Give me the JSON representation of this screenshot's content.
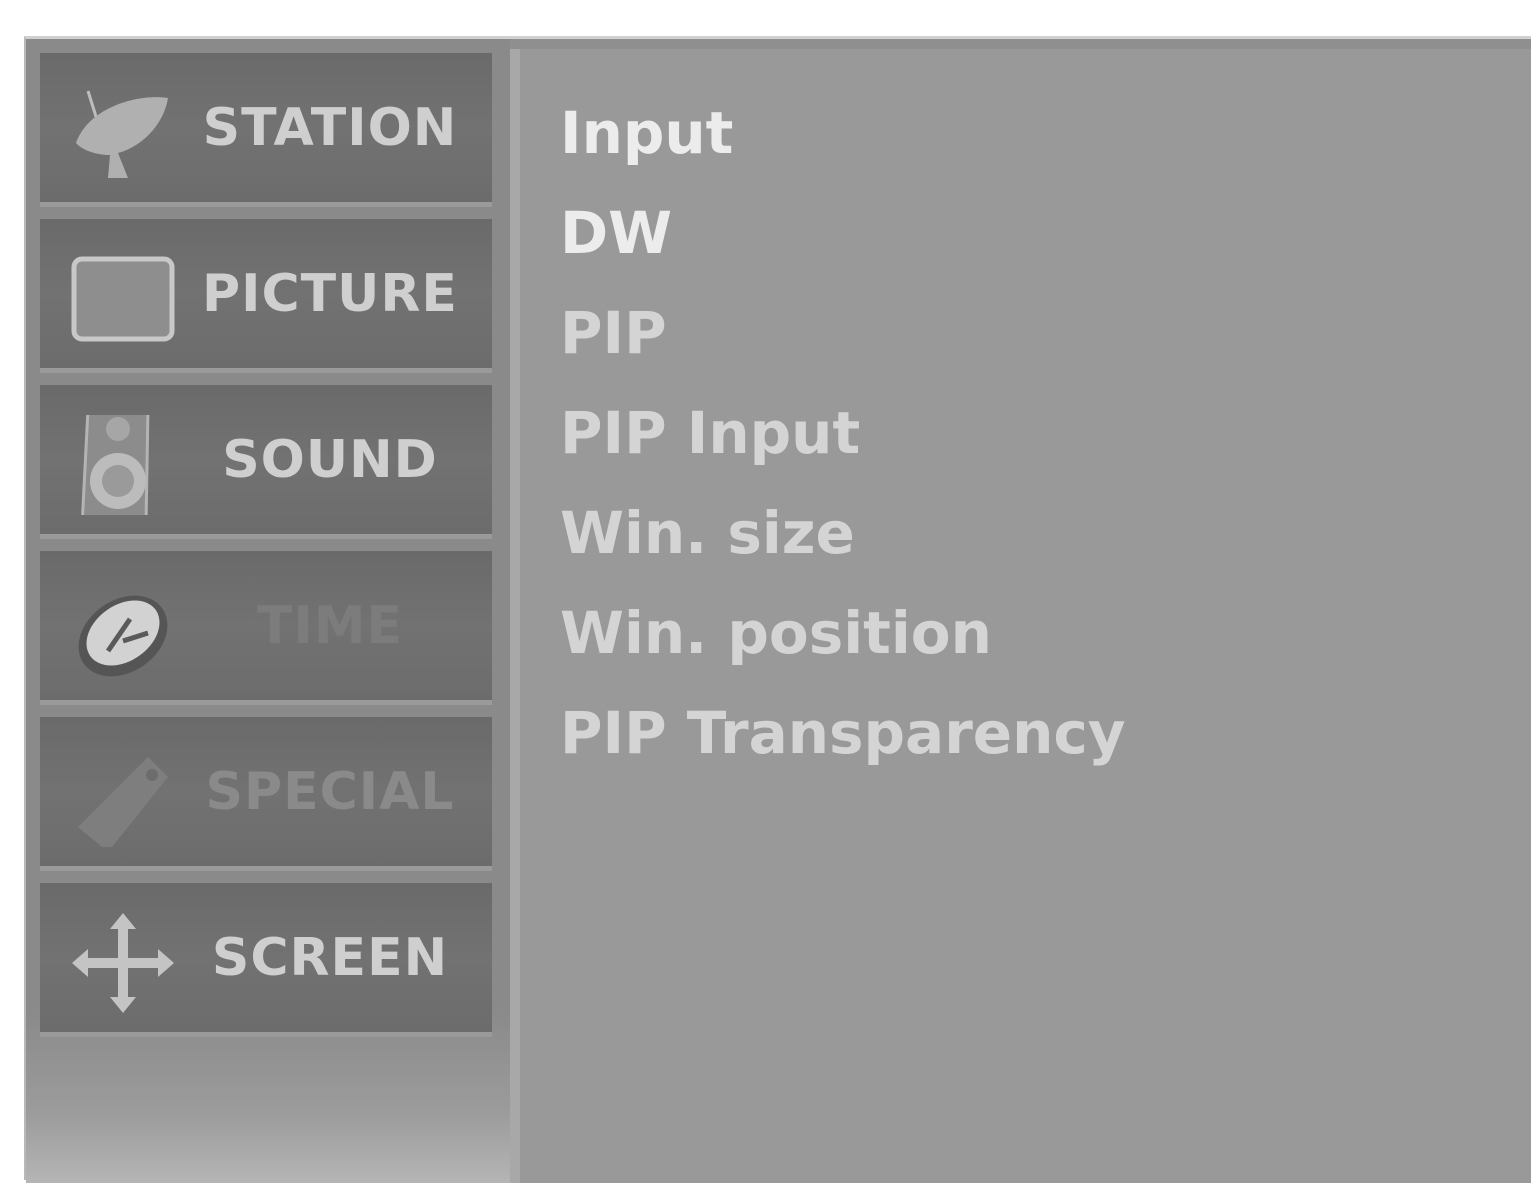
{
  "sidebar": {
    "tabs": [
      {
        "label": "STATION",
        "icon": "satellite-dish-icon"
      },
      {
        "label": "PICTURE",
        "icon": "tv-screen-icon"
      },
      {
        "label": "SOUND",
        "icon": "speaker-icon"
      },
      {
        "label": "TIME",
        "icon": "clock-icon"
      },
      {
        "label": "SPECIAL",
        "icon": "tag-icon"
      },
      {
        "label": "SCREEN",
        "icon": "move-arrows-icon"
      }
    ]
  },
  "menu": {
    "items": [
      "Input",
      "DW",
      "PIP",
      "PIP Input",
      "Win. size",
      "Win. position",
      "PIP Transparency"
    ]
  },
  "colors": {
    "panel": "#999999",
    "sidebar": "#8a8a8a",
    "text": "#ececec"
  }
}
